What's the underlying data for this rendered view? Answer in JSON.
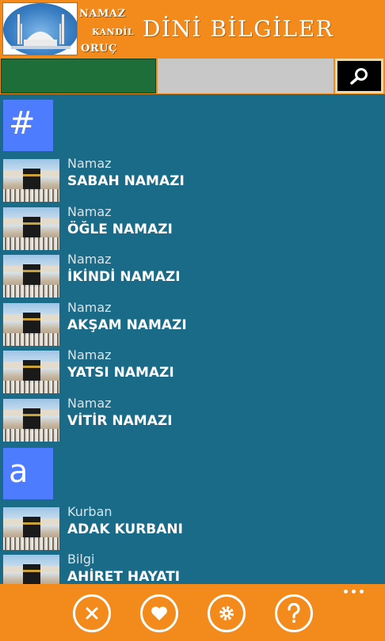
{
  "header": {
    "logo_words": [
      "NAMAZ",
      "KANDİL",
      "ORUÇ"
    ],
    "title": "DİNİ BİLGİLER"
  },
  "search": {
    "value": "",
    "placeholder": "",
    "button_icon": "search-icon"
  },
  "groups": [
    {
      "letter": "#",
      "items": [
        {
          "category": "Namaz",
          "title": "SABAH NAMAZI"
        },
        {
          "category": "Namaz",
          "title": "ÖĞLE NAMAZI"
        },
        {
          "category": "Namaz",
          "title": "İKİNDİ NAMAZI"
        },
        {
          "category": "Namaz",
          "title": "AKŞAM NAMAZI"
        },
        {
          "category": "Namaz",
          "title": "YATSI NAMAZI"
        },
        {
          "category": "Namaz",
          "title": "VİTİR NAMAZI"
        }
      ]
    },
    {
      "letter": "a",
      "items": [
        {
          "category": "Kurban",
          "title": "ADAK KURBANI"
        },
        {
          "category": "Bilgi",
          "title": "AHİRET HAYATI"
        }
      ]
    }
  ],
  "appbar": {
    "buttons": [
      "close-icon",
      "heart-icon",
      "gear-icon",
      "help-icon"
    ],
    "more_icon": "more-icon"
  },
  "colors": {
    "header_orange": "#f28a1c",
    "list_background": "#1a6b87",
    "group_tile": "#4d7cff",
    "tab_green": "#1e6e3a"
  }
}
